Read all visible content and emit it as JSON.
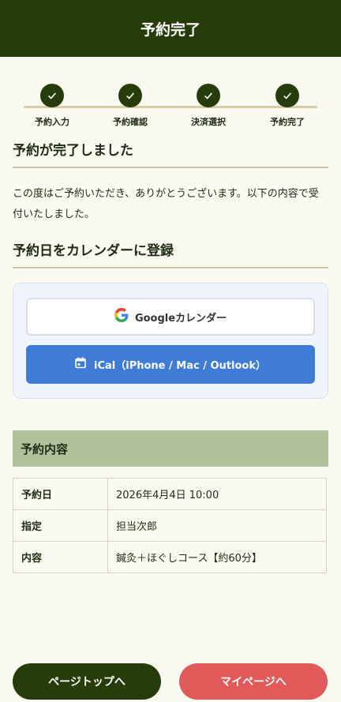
{
  "header": {
    "title": "予約完了"
  },
  "steps": [
    {
      "label": "予約入力"
    },
    {
      "label": "予約確認"
    },
    {
      "label": "決済選択"
    },
    {
      "label": "予約完了"
    }
  ],
  "completion": {
    "title": "予約が完了しました",
    "message": "この度はご予約いただき、ありがとうございます。以下の内容で受付いたしました。"
  },
  "calendar": {
    "title": "予約日をカレンダーに登録",
    "google_label": "Googleカレンダー",
    "ical_label": "iCal（iPhone / Mac / Outlook）"
  },
  "details": {
    "title": "予約内容",
    "rows": [
      {
        "label": "予約日",
        "value": "2026年4月4日 10:00"
      },
      {
        "label": "指定",
        "value": "担当次郎"
      },
      {
        "label": "内容",
        "value": "鍼灸＋ほぐしコース【約60分】"
      }
    ]
  },
  "footer": {
    "top_label": "ページトップへ",
    "mypage_label": "マイページへ"
  },
  "colors": {
    "primary": "#263d0b",
    "accent": "#e05a5a",
    "ical": "#3e7cd8"
  }
}
